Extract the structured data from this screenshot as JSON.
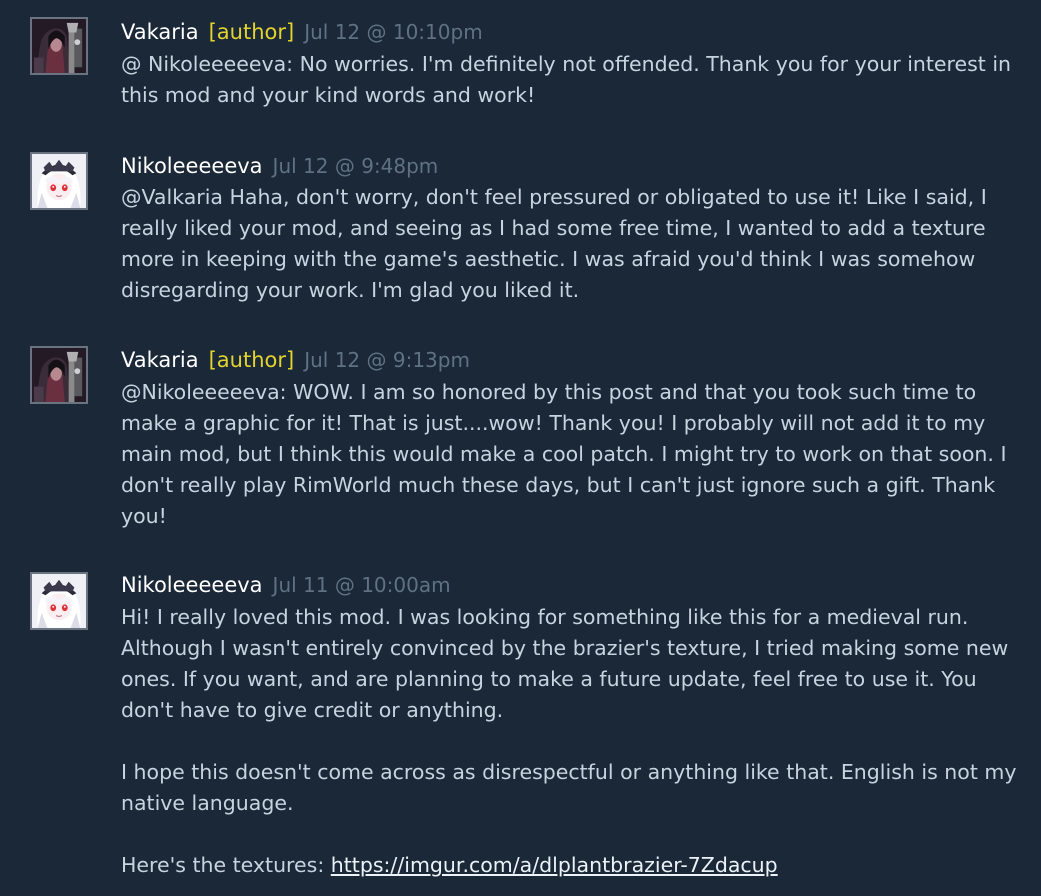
{
  "comments": [
    {
      "author": "Vakaria",
      "author_tag": "[author]",
      "timestamp": "Jul 12 @ 10:10pm",
      "avatar": "vakaria-avatar",
      "paragraphs": [
        "@ Nikoleeeeeva: No worries. I'm definitely not offended. Thank you for your interest in this mod and your kind words and work!"
      ]
    },
    {
      "author": "Nikoleeeeeva",
      "author_tag": "",
      "timestamp": "Jul 12 @ 9:48pm",
      "avatar": "nikoleeeeeva-avatar",
      "paragraphs": [
        "@Valkaria Haha, don't worry, don't feel pressured or obligated to use it! Like I said, I really liked your mod, and seeing as I had some free time, I wanted to add a texture more in keeping with the game's aesthetic. I was afraid you'd think I was somehow disregarding your work. I'm glad you liked it."
      ]
    },
    {
      "author": "Vakaria",
      "author_tag": "[author]",
      "timestamp": "Jul 12 @ 9:13pm",
      "avatar": "vakaria-avatar",
      "paragraphs": [
        "@Nikoleeeeeva: WOW. I am so honored by this post and that you took such time to make a graphic for it! That is just....wow! Thank you! I probably will not add it to my main mod, but I think this would make a cool patch. I might try to work on that soon. I don't really play RimWorld much these days, but I can't just ignore such a gift. Thank you!"
      ]
    },
    {
      "author": "Nikoleeeeeva",
      "author_tag": "",
      "timestamp": "Jul 11 @ 10:00am",
      "avatar": "nikoleeeeeva-avatar",
      "paragraphs": [
        "Hi! I really loved this mod. I was looking for something like this for a medieval run. Although I wasn't entirely convinced by the brazier's texture, I tried making some new ones. If you want, and are planning to make a future update, feel free to use it. You don't have to give credit or anything.",
        "I hope this doesn't come across as disrespectful or anything like that. English is not my native language."
      ],
      "link_prefix": "Here's the textures: ",
      "link_text": "https://imgur.com/a/dlplantbrazier-7Zdacup"
    }
  ],
  "colors": {
    "background": "#1b2838",
    "author_name": "#ffffff",
    "author_tag": "#e3d330",
    "timestamp": "#5f7282",
    "body_text": "#c6d4df"
  }
}
